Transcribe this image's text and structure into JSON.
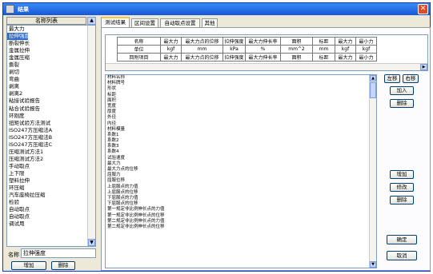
{
  "window": {
    "title": "结果"
  },
  "left": {
    "header": "名称列表",
    "items": [
      "最大力",
      "拉伸强度",
      "断裂伸长",
      "金属拉伸",
      "金属压缩",
      "撕裂",
      "剥切",
      "弯曲",
      "剥离",
      "剥离2",
      "粘接试验报告",
      "粘合试验报告",
      "环刚度",
      "扭矩试验方法测试",
      "ISO247方压缩法A",
      "ISO247方压缩法B",
      "ISO247方压缩法C",
      "压缩测试方法1",
      "压缩测试方法2",
      "手动取点",
      "上下限",
      "塑料拉伸",
      "环压缩",
      "汽车座椅拉压缩",
      "检验",
      "自动取点",
      "自动取点",
      "调试用"
    ],
    "selected_index": 1,
    "name_label": "名称",
    "name_value": "拉伸强度",
    "add_label": "增加",
    "delete_label": "删除"
  },
  "tabs": [
    "测试结果",
    "区间设置",
    "自动取点设置",
    "其他"
  ],
  "grid": {
    "columns": [
      "名称",
      "最大力",
      "最大力点的位移",
      "拉伸强度",
      "最大力伸长率",
      "面积",
      "标距",
      "最大力",
      "最小力"
    ],
    "rows": [
      [
        "单位",
        "kgf",
        "mm",
        "kPa",
        "%",
        "mm^2",
        "mm",
        "kgf",
        "kgf"
      ],
      [
        "回附项目",
        "最大力",
        "最大力点的位移",
        "拉伸强度",
        "最大力伸长率",
        "面积",
        "标距",
        "最大力",
        "最小力"
      ]
    ]
  },
  "param_list": [
    "材料名称",
    "材料牌号",
    "形状",
    "标距",
    "面积",
    "宽度",
    "厚度",
    "外径",
    "内径",
    "材料模量",
    "系数1",
    "系数2",
    "系数3",
    "系数4",
    "试验速度",
    "最大力",
    "最大力点的位移",
    "屈服力",
    "屈服位移",
    "上屈服点的力值",
    "上屈服点的位移",
    "下屈服点的力值",
    "下屈服点的位移",
    "第一规定非比例伸长点的力值",
    "第一规定非比例伸长点的位移",
    "第二规定非比例伸长点的力值",
    "第二规定非比例伸长点的位移"
  ],
  "buttons": {
    "move_left": "左移",
    "move_right": "右移",
    "add": "加入",
    "remove": "删除",
    "add2": "增加",
    "edit": "修改",
    "delete2": "删除",
    "ok": "确定",
    "cancel": "取消"
  }
}
